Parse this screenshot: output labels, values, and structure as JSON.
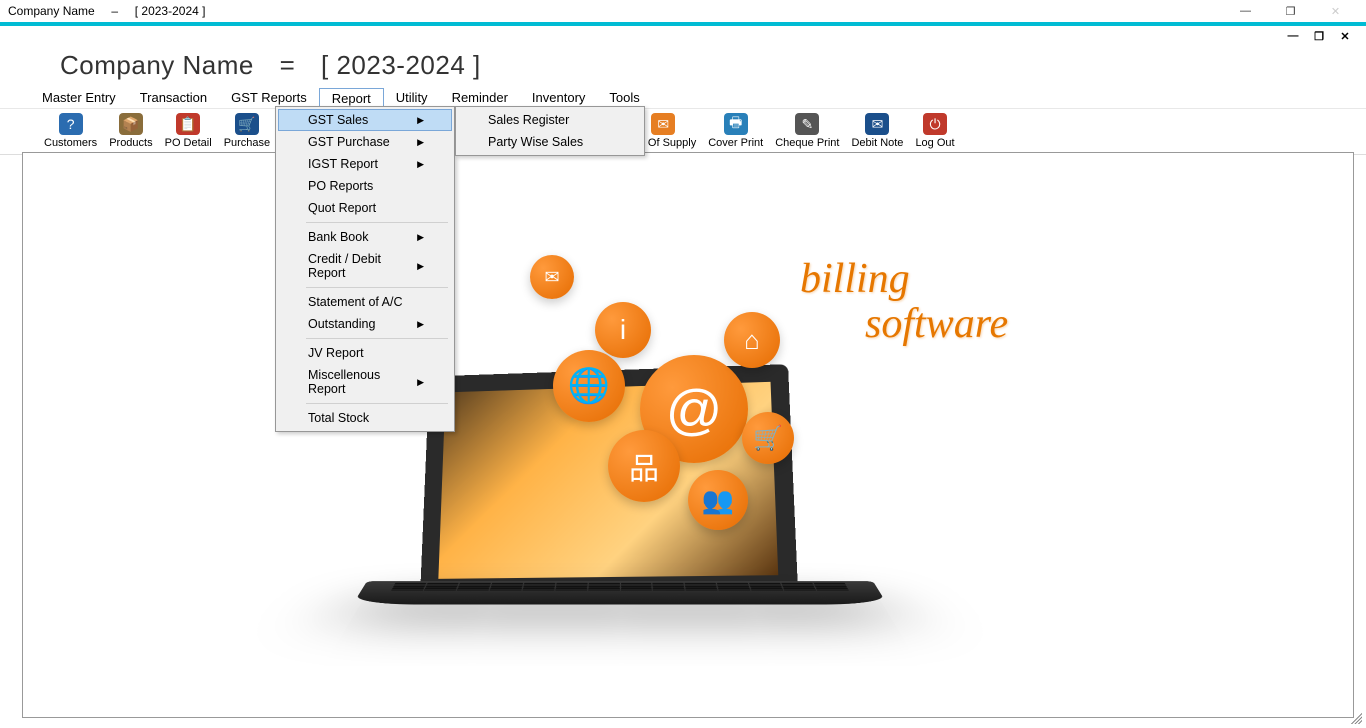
{
  "titlebar": {
    "company": "Company Name",
    "sep": "–",
    "period": "[   2023-2024   ]"
  },
  "header": {
    "company": "Company Name",
    "eq": "=",
    "period": "[   2023-2024   ]"
  },
  "menubar": [
    "Master Entry",
    "Transaction",
    "GST Reports",
    "Report",
    "Utility",
    "Reminder",
    "Inventory",
    "Tools"
  ],
  "menubar_active_index": 3,
  "toolbar": [
    {
      "label": "Customers",
      "icon": "customers-icon",
      "color": "#2b6cb0",
      "glyph": "?"
    },
    {
      "label": "Products",
      "icon": "products-icon",
      "color": "#8a6d3b",
      "glyph": "📦"
    },
    {
      "label": "PO Detail",
      "icon": "po-detail-icon",
      "color": "#c0392b",
      "glyph": "📋"
    },
    {
      "label": "Purchase",
      "icon": "purchase-icon",
      "color": "#1b4f8b",
      "glyph": "🛒"
    },
    {
      "label": "",
      "icon": "hidden",
      "color": "",
      "glyph": ""
    },
    {
      "label": "",
      "icon": "hidden",
      "color": "",
      "glyph": ""
    },
    {
      "label": "",
      "icon": "hidden",
      "color": "",
      "glyph": ""
    },
    {
      "label": "",
      "icon": "hidden",
      "color": "",
      "glyph": ""
    },
    {
      "label": "",
      "icon": "hidden",
      "color": "",
      "glyph": ""
    },
    {
      "label": "",
      "icon": "hidden",
      "color": "",
      "glyph": ""
    },
    {
      "label": "Bill Of Supply",
      "icon": "bill-icon",
      "color": "#e67e22",
      "glyph": "✉"
    },
    {
      "label": "Cover Print",
      "icon": "cover-print-icon",
      "color": "#2980b9",
      "glyph": "🖶"
    },
    {
      "label": "Cheque Print",
      "icon": "cheque-print-icon",
      "color": "#555",
      "glyph": "✎"
    },
    {
      "label": "Debit Note",
      "icon": "debit-note-icon",
      "color": "#1b4f8b",
      "glyph": "✉"
    },
    {
      "label": "Log Out",
      "icon": "logout-icon",
      "color": "#c0392b",
      "glyph": "⏻"
    }
  ],
  "dropdown": {
    "items": [
      {
        "label": "GST Sales",
        "arrow": true,
        "hl": true
      },
      {
        "label": "GST Purchase",
        "arrow": true
      },
      {
        "label": "IGST Report",
        "arrow": true
      },
      {
        "label": "PO Reports",
        "arrow": false
      },
      {
        "label": "Quot Report",
        "arrow": false
      },
      {
        "sep": true
      },
      {
        "label": "Bank Book",
        "arrow": true
      },
      {
        "label": "Credit / Debit Report",
        "arrow": true
      },
      {
        "sep": true
      },
      {
        "label": "Statement of A/C",
        "arrow": false
      },
      {
        "label": "Outstanding",
        "arrow": true
      },
      {
        "sep": true
      },
      {
        "label": "JV Report",
        "arrow": false
      },
      {
        "label": "Miscellenous Report",
        "arrow": true
      },
      {
        "sep": true
      },
      {
        "label": "Total Stock",
        "arrow": false
      }
    ]
  },
  "submenu": {
    "items": [
      {
        "label": "Sales Register"
      },
      {
        "label": "Party Wise Sales"
      }
    ]
  },
  "brand": {
    "line1": "billing",
    "line2": "software"
  }
}
